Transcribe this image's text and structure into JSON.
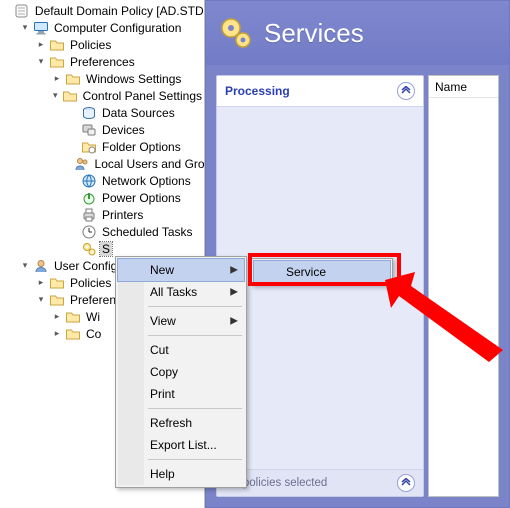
{
  "tree": {
    "root_label": "Default Domain Policy [AD.STD",
    "computer_config": "Computer Configuration",
    "policies": "Policies",
    "preferences": "Preferences",
    "windows_settings": "Windows Settings",
    "control_panel": "Control Panel Settings",
    "cp_items": {
      "data_sources": "Data Sources",
      "devices": "Devices",
      "folder_options": "Folder Options",
      "local_users": "Local Users and Groups",
      "network_options": "Network Options",
      "power_options": "Power Options",
      "printers": "Printers",
      "scheduled_tasks": "Scheduled Tasks",
      "services_trunc": "S"
    },
    "user_config": "User Configuration",
    "user_policies": "Policies",
    "user_preferences": "Preferences",
    "user_wi": "Wi",
    "user_co": "Co"
  },
  "right": {
    "title": "Services",
    "card_title": "Processing",
    "footer_text": "No policies selected",
    "list_header": "Name"
  },
  "menu": {
    "new": "New",
    "all_tasks": "All Tasks",
    "view": "View",
    "cut": "Cut",
    "copy": "Copy",
    "print": "Print",
    "refresh": "Refresh",
    "export": "Export List...",
    "help": "Help"
  },
  "submenu": {
    "service": "Service"
  },
  "colors": {
    "accent": "#7b84c8",
    "highlight": "#ff0000"
  }
}
